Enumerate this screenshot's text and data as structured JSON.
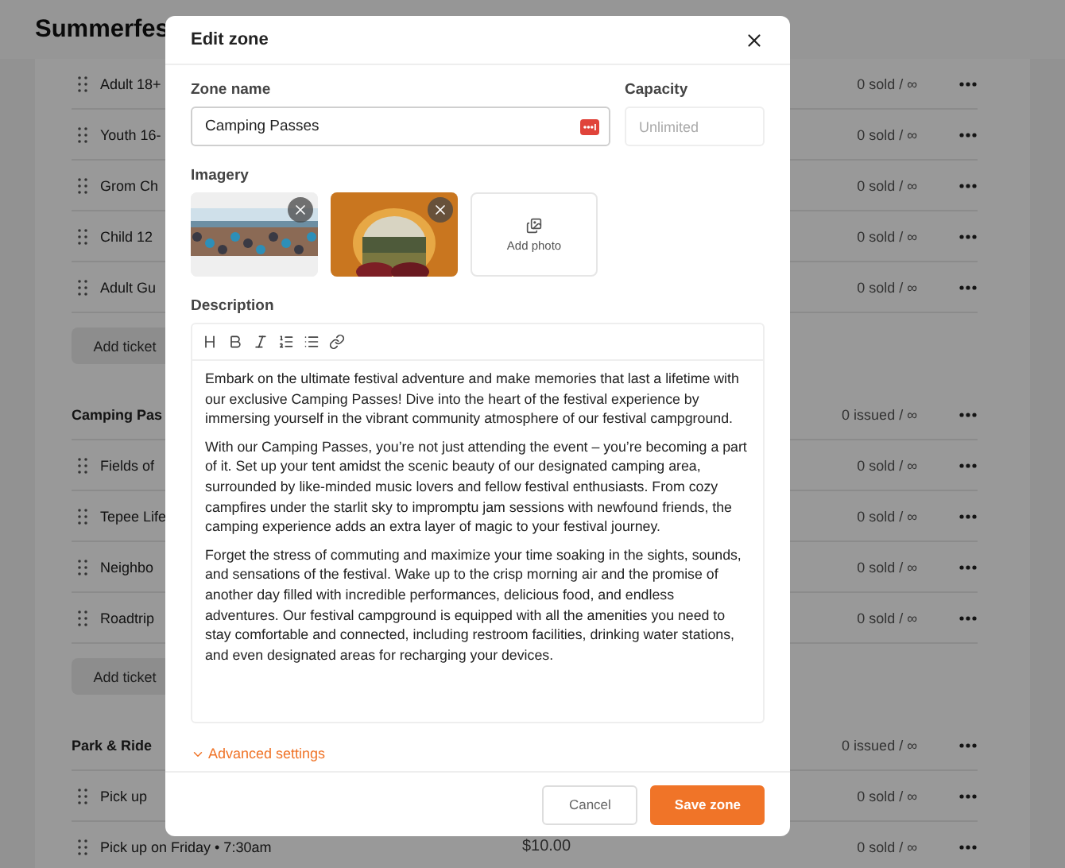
{
  "page": {
    "title": "Summerfes"
  },
  "list": [
    {
      "kind": "ticket",
      "label": "Adult 18+",
      "status": "0 sold / ∞"
    },
    {
      "kind": "ticket",
      "label": "Youth 16-",
      "status": "0 sold / ∞"
    },
    {
      "kind": "ticket",
      "label": "Grom Ch",
      "status": "0 sold / ∞"
    },
    {
      "kind": "ticket",
      "label": "Child 12",
      "status": "0 sold / ∞"
    },
    {
      "kind": "ticket",
      "label": "Adult Gu",
      "status": "0 sold / ∞"
    },
    {
      "kind": "add",
      "label": "Add ticket"
    },
    {
      "kind": "group",
      "label": "Camping Pas",
      "status": "0 issued / ∞"
    },
    {
      "kind": "ticket",
      "label": "Fields of",
      "status": "0 sold / ∞"
    },
    {
      "kind": "ticket",
      "label": "Tepee Life",
      "status": "0 sold / ∞"
    },
    {
      "kind": "ticket",
      "label": "Neighbo",
      "status": "0 sold / ∞"
    },
    {
      "kind": "ticket",
      "label": "Roadtrip",
      "status": "0 sold / ∞"
    },
    {
      "kind": "add",
      "label": "Add ticket"
    },
    {
      "kind": "group",
      "label": "Park & Ride",
      "status": "0 issued / ∞"
    },
    {
      "kind": "ticket",
      "label": "Pick up",
      "status": "0 sold / ∞"
    },
    {
      "kind": "ticket",
      "label": "Pick up on Friday • 7:30am",
      "price": "$10.00",
      "status": "0 sold / ∞"
    }
  ],
  "modal": {
    "title": "Edit zone",
    "zone_name": {
      "label": "Zone name",
      "value": "Camping Passes"
    },
    "capacity": {
      "label": "Capacity",
      "placeholder": "Unlimited"
    },
    "imagery": {
      "label": "Imagery",
      "photos": [
        {
          "kind": "beach"
        },
        {
          "kind": "tent"
        }
      ],
      "add_label": "Add photo"
    },
    "description": {
      "label": "Description",
      "paragraphs": [
        "Embark on the ultimate festival adventure and make memories that last a lifetime with our exclusive Camping Passes! Dive into the heart of the festival experience by immersing yourself in the vibrant community atmosphere of our festival campground.",
        "With our Camping Passes, you’re not just attending the event – you’re becoming a part of it. Set up your tent amidst the scenic beauty of our designated camping area, surrounded by like-minded music lovers and fellow festival enthusiasts. From cozy campfires under the starlit sky to impromptu jam sessions with newfound friends, the camping experience adds an extra layer of magic to your festival journey.",
        "Forget the stress of commuting and maximize your time soaking in the sights, sounds, and sensations of the festival. Wake up to the crisp morning air and the promise of another day filled with incredible performances, delicious food, and endless adventures. Our festival campground is equipped with all the amenities you need to stay comfortable and connected, including restroom facilities, drinking water stations, and even designated areas for recharging your devices."
      ]
    },
    "advanced": {
      "label": "Advanced settings"
    },
    "buttons": [
      {
        "label": "Cancel",
        "kind": "secondary"
      },
      {
        "label": "Save zone",
        "kind": "primary"
      }
    ]
  }
}
